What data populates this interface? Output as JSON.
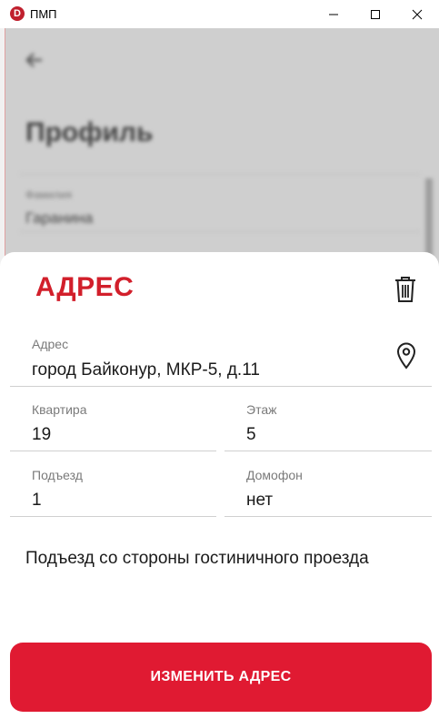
{
  "window": {
    "app_icon_letter": "D",
    "title": "ПМП"
  },
  "background": {
    "page_title": "Профиль",
    "field_label": "Фамилия",
    "field_value": "Гаранина"
  },
  "sheet": {
    "title": "АДРЕС",
    "address": {
      "label": "Адрес",
      "value": "город Байконур, МКР-5, д.11"
    },
    "apartment": {
      "label": "Квартира",
      "value": "19"
    },
    "floor": {
      "label": "Этаж",
      "value": "5"
    },
    "entrance": {
      "label": "Подъезд",
      "value": "1"
    },
    "intercom": {
      "label": "Домофон",
      "value": "нет"
    },
    "comment": "Подъезд со стороны гостиничного проезда",
    "button_label": "ИЗМЕНИТЬ АДРЕС"
  },
  "colors": {
    "accent": "#d21f2b",
    "button": "#e01a32"
  },
  "icons": [
    "back-arrow-icon",
    "trash-icon",
    "map-pin-icon",
    "minimize-icon",
    "maximize-icon",
    "close-icon"
  ]
}
